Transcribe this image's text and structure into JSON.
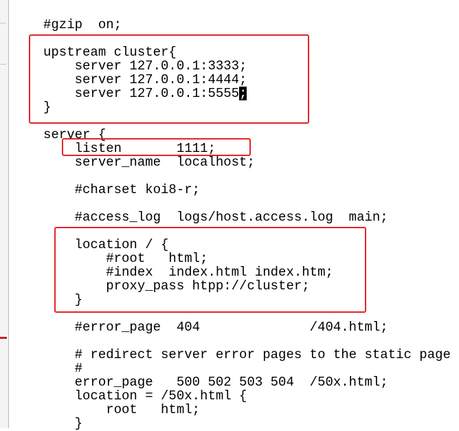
{
  "editor": {
    "lines": [
      "#gzip  on;",
      "upstream cluster{",
      "    server 127.0.0.1:3333;",
      "    server 127.0.0.1:4444;",
      "    server 127.0.0.1:5555",
      "}",
      "server {",
      "    listen       1111;",
      "    server_name  localhost;",
      "    #charset koi8-r;",
      "    #access_log  logs/host.access.log  main;",
      "    location / {",
      "        #root   html;",
      "        #index  index.html index.htm;",
      "        proxy_pass htpp://cluster;",
      "    }",
      "    #error_page  404              /404.html;",
      "    # redirect server error pages to the static page",
      "    #",
      "    error_page   500 502 503 504  /50x.html;",
      "    location = /50x.html {",
      "        root   html;",
      "    }"
    ],
    "cursor_char": ";"
  },
  "colors": {
    "highlight": "#e0262a",
    "text": "#000000",
    "background": "#ffffff"
  }
}
